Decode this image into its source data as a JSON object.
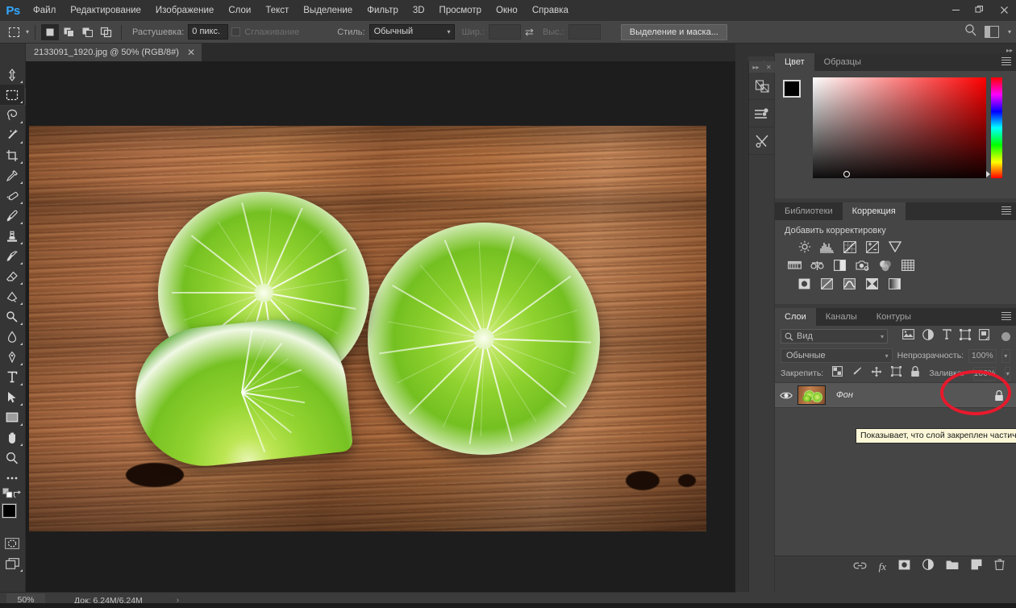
{
  "app": {
    "logo": "Ps",
    "title": "Adobe Photoshop"
  },
  "menubar": {
    "items": [
      {
        "label": "Файл"
      },
      {
        "label": "Редактирование"
      },
      {
        "label": "Изображение"
      },
      {
        "label": "Слои"
      },
      {
        "label": "Текст"
      },
      {
        "label": "Выделение"
      },
      {
        "label": "Фильтр"
      },
      {
        "label": "3D"
      },
      {
        "label": "Просмотр"
      },
      {
        "label": "Окно"
      },
      {
        "label": "Справка"
      }
    ]
  },
  "window_controls": {
    "minimize": "—",
    "restore": "❐",
    "close": "✕"
  },
  "optionsbar": {
    "feather_label": "Растушевка:",
    "feather_value": "0 пикс.",
    "antialias_label": "Сглаживание",
    "style_label": "Стиль:",
    "style_value": "Обычный",
    "width_label": "Шир.:",
    "width_value": "",
    "height_label": "Выс.:",
    "height_value": "",
    "select_mask_button": "Выделение и маска...",
    "selection_modes": [
      "new-selection",
      "add-to-selection",
      "subtract-from-selection",
      "intersect-selection"
    ]
  },
  "toolbar": {
    "tools": [
      {
        "name": "move-tool",
        "active": false
      },
      {
        "name": "rectangular-marquee-tool",
        "active": true
      },
      {
        "name": "lasso-tool",
        "active": false
      },
      {
        "name": "magic-wand-tool",
        "active": false
      },
      {
        "name": "crop-tool",
        "active": false
      },
      {
        "name": "eyedropper-tool",
        "active": false
      },
      {
        "name": "healing-brush-tool",
        "active": false
      },
      {
        "name": "brush-tool",
        "active": false
      },
      {
        "name": "clone-stamp-tool",
        "active": false
      },
      {
        "name": "history-brush-tool",
        "active": false
      },
      {
        "name": "eraser-tool",
        "active": false
      },
      {
        "name": "gradient-tool",
        "active": false
      },
      {
        "name": "dodge-tool",
        "active": false
      },
      {
        "name": "blur-tool",
        "active": false
      },
      {
        "name": "pen-tool",
        "active": false
      },
      {
        "name": "type-tool",
        "active": false
      },
      {
        "name": "path-selection-tool",
        "active": false
      },
      {
        "name": "rectangle-tool",
        "active": false
      },
      {
        "name": "hand-tool",
        "active": false
      },
      {
        "name": "zoom-tool",
        "active": false
      },
      {
        "name": "edit-toolbar-tool",
        "active": false
      }
    ],
    "foreground_color": "#000000",
    "background_color": "#ffffff"
  },
  "document": {
    "tab_title": "2133091_1920.jpg @ 50% (RGB/8#)",
    "close_glyph": "✕"
  },
  "canvas": {
    "description": "Три дольки лайма на деревянной поверхности"
  },
  "panels": {
    "color": {
      "tabs": [
        {
          "label": "Цвет",
          "active": true
        },
        {
          "label": "Образцы",
          "active": false
        }
      ]
    },
    "adjustments": {
      "tabs": [
        {
          "label": "Библиотеки",
          "active": false
        },
        {
          "label": "Коррекция",
          "active": true
        }
      ],
      "title": "Добавить корректировку",
      "row1": [
        "brightness-contrast-icon",
        "levels-icon",
        "curves-icon",
        "exposure-icon",
        "vibrance-icon"
      ],
      "row2": [
        "hue-saturation-icon",
        "color-balance-icon",
        "black-white-icon",
        "photo-filter-icon",
        "channel-mixer-icon",
        "color-lookup-icon"
      ],
      "row3": [
        "invert-icon",
        "posterize-icon",
        "threshold-icon",
        "selective-color-icon",
        "gradient-map-icon"
      ]
    },
    "layers": {
      "tabs": [
        {
          "label": "Слои",
          "active": true
        },
        {
          "label": "Каналы",
          "active": false
        },
        {
          "label": "Контуры",
          "active": false
        }
      ],
      "filter_placeholder": "Вид",
      "blend_mode": "Обычные",
      "opacity_label": "Непрозрачность:",
      "opacity_value": "100%",
      "lock_label": "Закрепить:",
      "fill_label": "Заливка:",
      "fill_value": "100%",
      "rows": [
        {
          "name": "Фон",
          "visible": true,
          "locked": true
        }
      ],
      "tooltip": "Показывает, что слой закреплен частично",
      "bottom_icons": [
        "link-layers-icon",
        "layer-style-fx-icon",
        "add-layer-mask-icon",
        "new-adjustment-layer-icon",
        "new-group-icon",
        "new-layer-icon",
        "delete-layer-icon"
      ]
    }
  },
  "statusbar": {
    "zoom": "50%",
    "doc_info": "Док: 6,24M/6,24M",
    "expand_glyph": "›"
  },
  "annotation": {
    "highlight_color": "#e8192c",
    "target": "layer-lock-icon"
  }
}
